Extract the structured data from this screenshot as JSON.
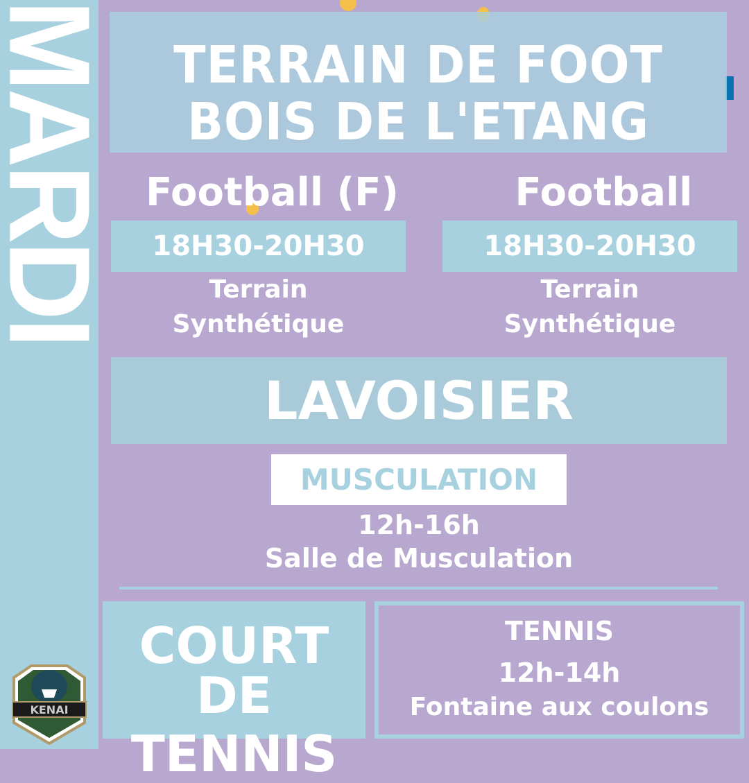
{
  "day": "MARDI",
  "venue1": {
    "title_line1": "TERRAIN DE FOOT",
    "title_line2": "BOIS DE L'ETANG",
    "activities": [
      {
        "name": "Football (F)",
        "time": "18H30-20H30",
        "place_line1": "Terrain",
        "place_line2": "Synthétique"
      },
      {
        "name": "Football",
        "time": "18H30-20H30",
        "place_line1": "Terrain",
        "place_line2": "Synthétique"
      }
    ]
  },
  "venue2": {
    "title": "LAVOISIER",
    "activity": "MUSCULATION",
    "time": "12h-16h",
    "place": "Salle de Musculation"
  },
  "venue3": {
    "title_line1": "COURT DE",
    "title_line2": "TENNIS",
    "activity": "TENNIS",
    "time": "12h-14h",
    "place": "Fontaine aux coulons"
  },
  "logo": {
    "text": "KENAI"
  },
  "colors": {
    "background": "#b8a8d0",
    "accent": "#a7d1de",
    "text": "#ffffff"
  }
}
